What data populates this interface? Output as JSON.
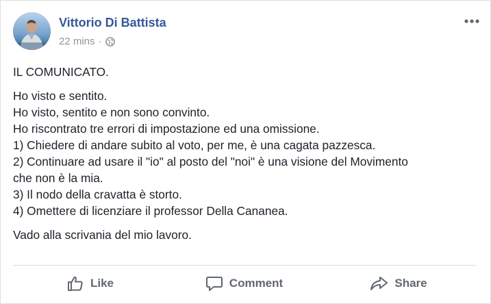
{
  "post": {
    "author": "Vittorio Di Battista",
    "time": "22 mins",
    "separator": "·",
    "privacy_icon": "globe-icon",
    "more_icon": "more-options-icon",
    "paragraphs": [
      [
        "IL COMUNICATO."
      ],
      [
        "Ho visto e sentito.",
        "Ho visto, sentito e non sono convinto.",
        "Ho riscontrato tre errori di impostazione ed una omissione.",
        "1) Chiedere di andare subito al voto, per me, è una cagata pazzesca.",
        "2) Continuare ad usare il \"io\" al posto del \"noi\" è una visione del Movimento",
        "che non è la mia.",
        "3) Il nodo della cravatta è storto.",
        "4) Omettere di licenziare il professor Della Cananea."
      ],
      [
        "Vado alla scrivania del mio lavoro."
      ]
    ]
  },
  "actions": {
    "like": "Like",
    "comment": "Comment",
    "share": "Share"
  },
  "colors": {
    "author_link": "#365899",
    "meta_text": "#90949c",
    "body_text": "#1d2129",
    "action_text": "#606770"
  }
}
